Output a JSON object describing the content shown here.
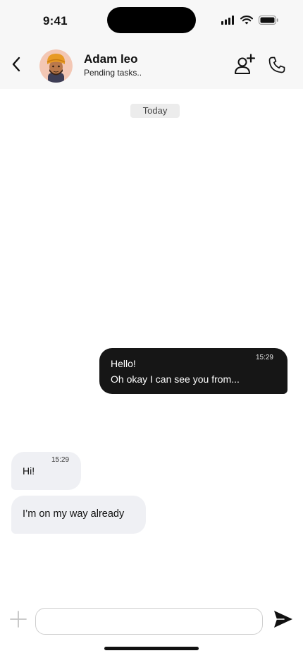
{
  "status_bar": {
    "time": "9:41",
    "icons": [
      "cellular-signal-icon",
      "wifi-icon",
      "battery-icon"
    ]
  },
  "header": {
    "back_icon": "chevron-left-icon",
    "contact_name": "Adam leo",
    "contact_status": "Pending tasks..",
    "actions": [
      "add-user-icon",
      "phone-icon"
    ]
  },
  "conversation": {
    "date_label": "Today",
    "messages": [
      {
        "direction": "outgoing",
        "time": "15:29",
        "lines": [
          "Hello!",
          "Oh okay I can see you from..."
        ]
      },
      {
        "direction": "incoming",
        "time": "15:29",
        "text": "Hi!"
      },
      {
        "direction": "incoming",
        "text": "I’m on my way already"
      }
    ]
  },
  "composer": {
    "attach_icon": "plus-icon",
    "input_value": "",
    "send_icon": "send-icon"
  },
  "colors": {
    "outgoing_bubble": "#161616",
    "incoming_bubble": "#eff0f4",
    "header_bg": "#f7f7f7",
    "date_chip": "#ececec"
  }
}
